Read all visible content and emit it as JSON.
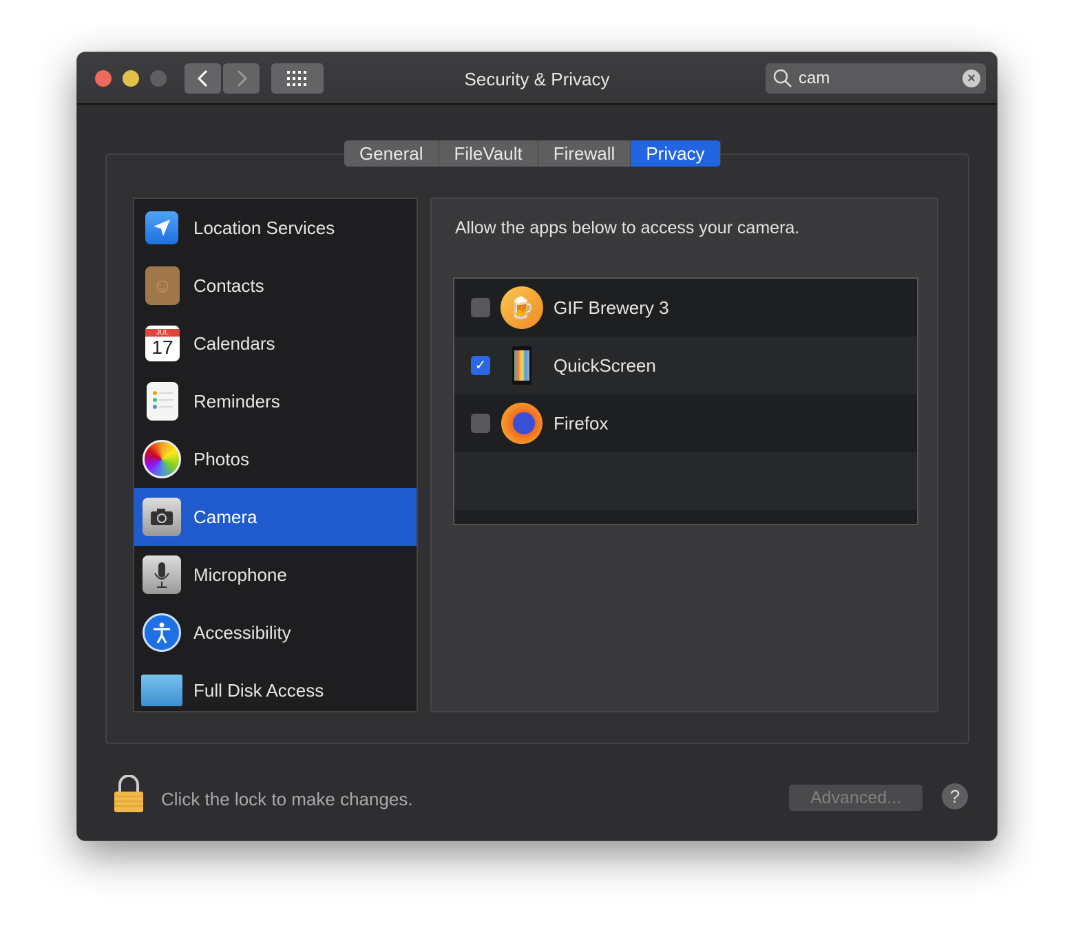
{
  "window": {
    "title": "Security & Privacy"
  },
  "search": {
    "value": "cam"
  },
  "tabs": [
    {
      "label": "General"
    },
    {
      "label": "FileVault"
    },
    {
      "label": "Firewall"
    },
    {
      "label": "Privacy",
      "active": true
    }
  ],
  "sidebar": {
    "items": [
      {
        "label": "Location Services",
        "icon": "location-arrow-icon"
      },
      {
        "label": "Contacts",
        "icon": "contacts-book-icon"
      },
      {
        "label": "Calendars",
        "icon": "calendar-icon",
        "month": "JUL",
        "day": "17"
      },
      {
        "label": "Reminders",
        "icon": "reminders-icon"
      },
      {
        "label": "Photos",
        "icon": "photos-icon"
      },
      {
        "label": "Camera",
        "icon": "camera-icon",
        "selected": true
      },
      {
        "label": "Microphone",
        "icon": "microphone-icon"
      },
      {
        "label": "Accessibility",
        "icon": "accessibility-icon"
      },
      {
        "label": "Full Disk Access",
        "icon": "folder-icon"
      }
    ]
  },
  "main": {
    "description": "Allow the apps below to access your camera.",
    "apps": [
      {
        "name": "GIF Brewery 3",
        "checked": false,
        "icon": "gif-brewery-icon"
      },
      {
        "name": "QuickScreen",
        "checked": true,
        "icon": "quickscreen-icon"
      },
      {
        "name": "Firefox",
        "checked": false,
        "icon": "firefox-icon"
      }
    ]
  },
  "footer": {
    "lock_text": "Click the lock to make changes.",
    "advanced_label": "Advanced...",
    "help_label": "?"
  },
  "colors": {
    "accent": "#1f5bcc",
    "close": "#ee6a5f",
    "minimize": "#e2c04a"
  }
}
